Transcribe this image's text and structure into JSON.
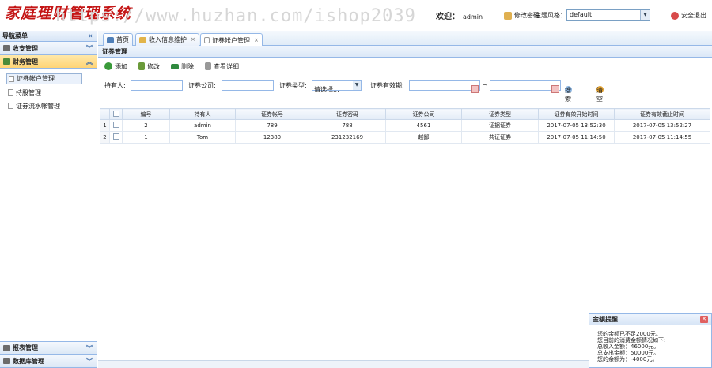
{
  "header": {
    "logo": "家庭理财管理系统",
    "watermark": "https://www.huzhan.com/ishop2039",
    "welcome_label": "欢迎：",
    "username": "admin",
    "change_password": "修改密码",
    "theme_label": "主题风格：",
    "theme_value": "default",
    "logout": "安全退出"
  },
  "sidebar": {
    "title": "导航菜单",
    "sections": [
      {
        "label": "收支管理",
        "icon": "ledger-icon"
      },
      {
        "label": "财务管理",
        "icon": "finance-icon"
      }
    ],
    "tree": [
      "证券帐户管理",
      "持股管理",
      "证券流水帐管理"
    ],
    "bottom_sections": [
      {
        "label": "报表管理",
        "icon": "chart-icon"
      },
      {
        "label": "数据库管理",
        "icon": "database-icon"
      }
    ]
  },
  "tabs": [
    {
      "label": "首页",
      "icon": "home-icon"
    },
    {
      "label": "收入信息维护",
      "icon": "folder-icon"
    },
    {
      "label": "证券帐户管理",
      "icon": "document-icon"
    }
  ],
  "panel": {
    "title": "证券管理",
    "toolbar": {
      "add": "添加",
      "edit": "修改",
      "delete": "删除",
      "view": "查看详细"
    },
    "search": {
      "holder_label": "持有人:",
      "company_label": "证券公司:",
      "type_label": "证券类型:",
      "type_value": "请选择...",
      "period_label": "证券有效期:",
      "range_sep": "~",
      "search_btn": "搜索",
      "clear_btn": "清空"
    },
    "columns": [
      "编号",
      "持有人",
      "证券帐号",
      "证券密码",
      "证券公司",
      "证券类型",
      "证券有效开始时间",
      "证券有效截止时间"
    ],
    "rows": [
      {
        "rn": "1",
        "id": "2",
        "holder": "admin",
        "account": "789",
        "password": "788",
        "company": "4561",
        "type": "证据证券",
        "start": "2017-07-05 13:52:30",
        "end": "2017-07-05 13:52:27"
      },
      {
        "rn": "2",
        "id": "1",
        "holder": "Tom",
        "account": "12380",
        "password": "231232169",
        "company": "越鄙",
        "type": "共证证券",
        "start": "2017-07-05 11:14:50",
        "end": "2017-07-05 11:14:55"
      }
    ]
  },
  "popup": {
    "title": "金额提醒",
    "lines": [
      "您的余额已不足2000元。",
      "您目前的消费金额情况如下:",
      "总收入金额：46000元。",
      "总支出金额：50000元。",
      "您的余额为：-4000元。"
    ]
  },
  "colors": {
    "accent": "#95b8e7",
    "active_section": "#ffd475",
    "logo": "#c41616"
  }
}
